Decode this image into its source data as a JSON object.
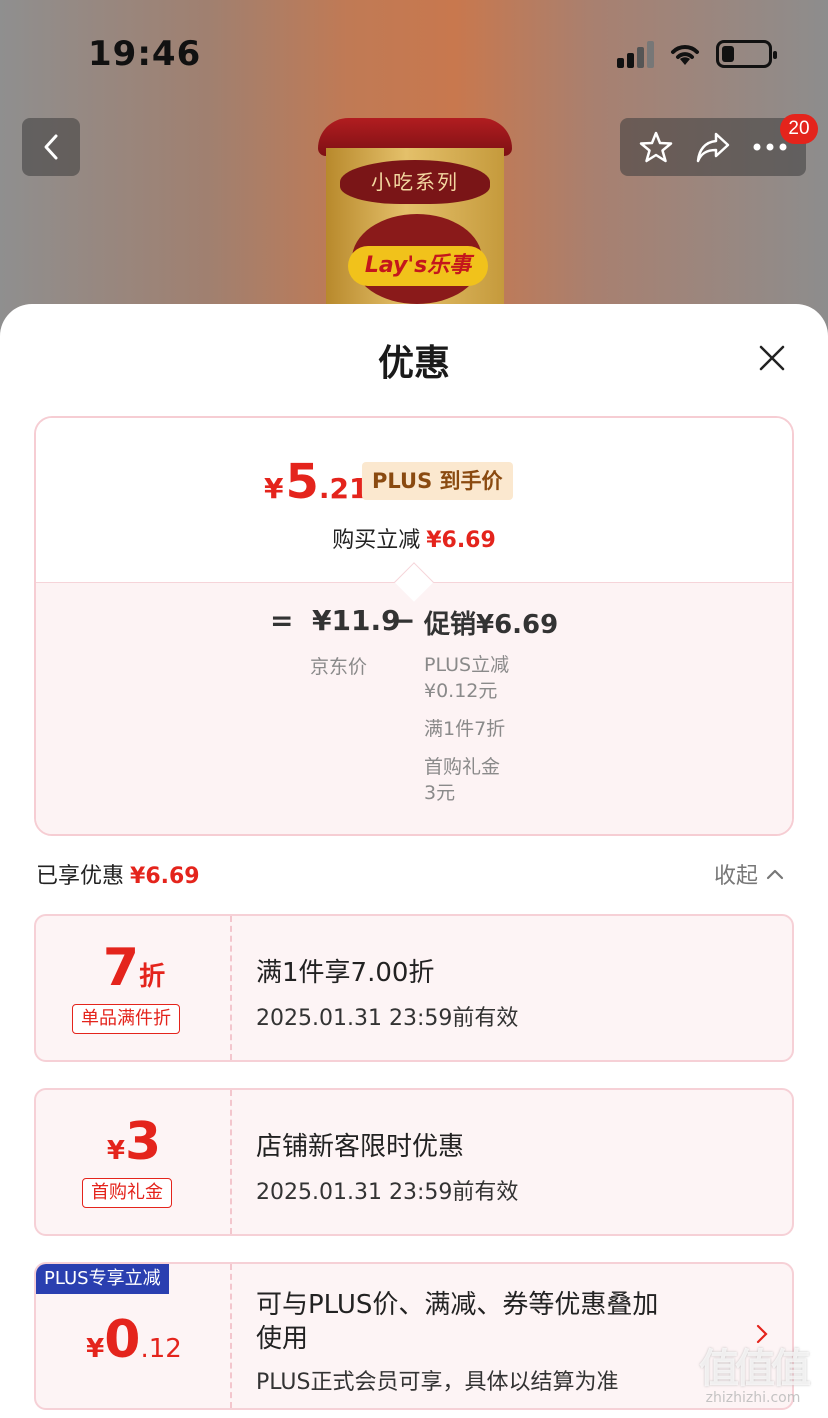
{
  "status_bar": {
    "time": "19:46"
  },
  "product": {
    "series_text": "小吃系列",
    "brand_text": "Lay's乐事"
  },
  "nav": {
    "notification_count": "20"
  },
  "sheet": {
    "title": "优惠",
    "summary": {
      "final_currency": "¥",
      "final_int": "5",
      "final_dec": ".21",
      "plus_tag": "PLUS 到手价",
      "buy_reduce_label": "购买立减",
      "buy_reduce_amount": "¥6.69",
      "eq": "=",
      "jd_price": "¥11.9",
      "jd_price_label": "京东价",
      "minus": "−",
      "promo": "促销¥6.69",
      "promo_details": [
        "PLUS立减",
        "¥0.12元",
        "满1件7折",
        "首购礼金",
        "3元"
      ]
    },
    "enjoyed": {
      "label": "已享优惠",
      "amount": "¥6.69",
      "collapse_label": "收起"
    },
    "coupons": [
      {
        "value_main": "7",
        "value_unit": "折",
        "tag": "单品满件折",
        "title": "满1件享7.00折",
        "validity": "2025.01.31 23:59前有效"
      },
      {
        "value_currency": "¥",
        "value_main": "3",
        "tag": "首购礼金",
        "title": "店铺新客限时优惠",
        "validity": "2025.01.31 23:59前有效"
      },
      {
        "ribbon": "PLUS专享立减",
        "value_currency": "¥",
        "value_main": "0",
        "value_dec": ".12",
        "title_line1": "可与PLUS价、满减、券等优惠叠加",
        "title_line2": "使用",
        "note": "PLUS正式会员可享，具体以结算为准"
      }
    ]
  },
  "watermark": {
    "mark": "值值值",
    "url": "zhizhizhi.com"
  },
  "colors": {
    "accent_red": "#e4241c",
    "plus_blue": "#2a3fb0",
    "plus_gold_bg": "#fbe8cf"
  }
}
